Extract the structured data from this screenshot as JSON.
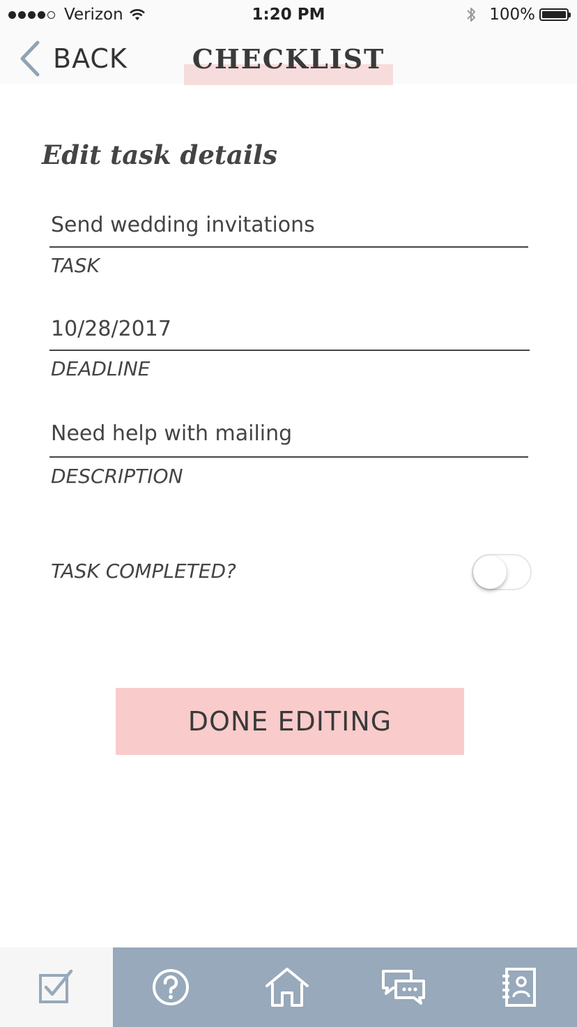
{
  "status_bar": {
    "carrier": "Verizon",
    "time": "1:20 PM",
    "battery": "100%"
  },
  "nav": {
    "back_label": "BACK",
    "title": "CHECKLIST"
  },
  "form": {
    "heading": "Edit task details",
    "task": {
      "value": "Send wedding invitations",
      "label": "TASK"
    },
    "deadline": {
      "value": "10/28/2017",
      "label": "DEADLINE"
    },
    "description": {
      "value": "Need help with mailing",
      "label": "DESCRIPTION"
    },
    "completed": {
      "label": "TASK COMPLETED?",
      "on": false
    }
  },
  "done_button_label": "DONE EDITING",
  "tab_bar": {
    "items": [
      {
        "icon": "checklist-icon",
        "active": true
      },
      {
        "icon": "help-icon",
        "active": false
      },
      {
        "icon": "home-icon",
        "active": false
      },
      {
        "icon": "chat-icon",
        "active": false
      },
      {
        "icon": "contacts-icon",
        "active": false
      }
    ]
  },
  "colors": {
    "accent_pink": "#f9cbcb",
    "title_highlight": "#f6dcdc",
    "tab_bar": "#97a9ba",
    "back_chevron": "#8fa3b5"
  }
}
